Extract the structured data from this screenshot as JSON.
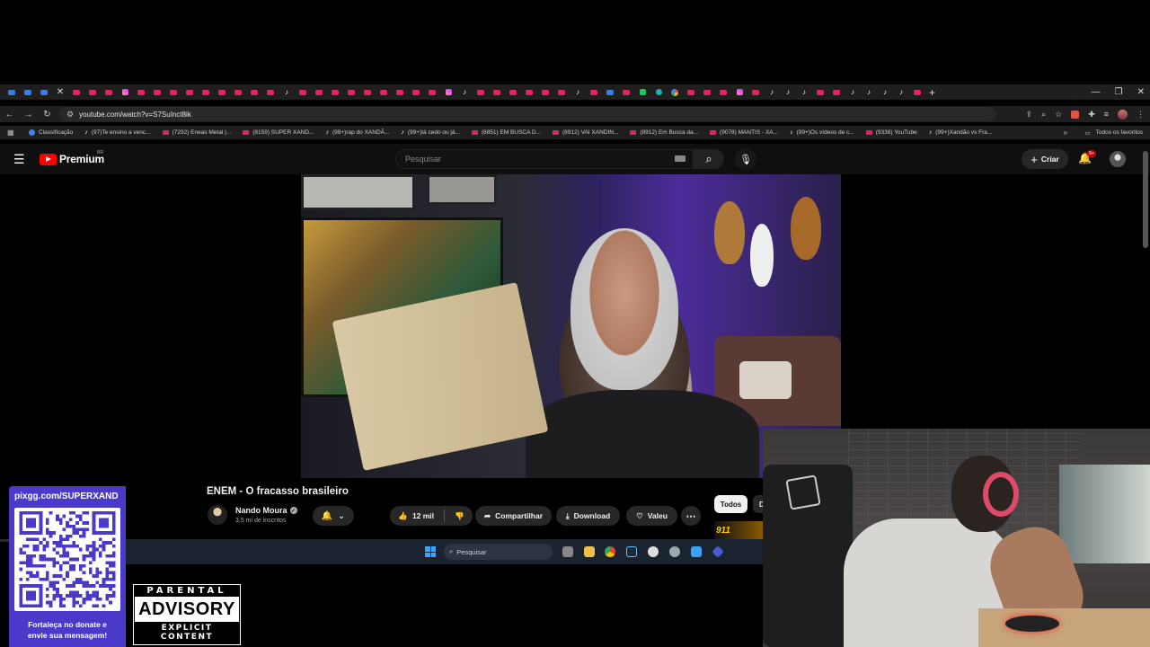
{
  "browser": {
    "url": "youtube.com/watch?v=S7SuInct8ik",
    "bookmarks": [
      {
        "label": "Classificação",
        "icon": "globe"
      },
      {
        "label": "(97)Te ensino a venc...",
        "icon": "tiktok"
      },
      {
        "label": "(7292) Eneas Metal |...",
        "icon": "youtube"
      },
      {
        "label": "(8159) SUPER XAND...",
        "icon": "youtube"
      },
      {
        "label": "(99+)rap do XANDÃ...",
        "icon": "tiktok"
      },
      {
        "label": "(99+)tá cedo ou já...",
        "icon": "tiktok"
      },
      {
        "label": "(8851) EM BUSCA D...",
        "icon": "youtube"
      },
      {
        "label": "(8912) VAI XANDIN...",
        "icon": "youtube"
      },
      {
        "label": "(8912) Em Busca da...",
        "icon": "youtube"
      },
      {
        "label": "(9078) MANTIS - XA...",
        "icon": "youtube"
      },
      {
        "label": "(99+)Os vídeos de c...",
        "icon": "tiktok"
      },
      {
        "label": "(9338) YouTube",
        "icon": "youtube"
      },
      {
        "label": "(99+)Xandão vs Fra...",
        "icon": "tiktok"
      }
    ],
    "all_bookmarks_label": "Todos os favoritos"
  },
  "youtube": {
    "logo_text": "Premium",
    "country": "BR",
    "search_placeholder": "Pesquisar",
    "create_label": "Criar",
    "notifications_badge": "9+",
    "video": {
      "title": "ENEM - O fracasso brasileiro",
      "channel": "Nando Moura",
      "subscribers": "3,5 mi de inscritos",
      "likes": "12 mil",
      "share_label": "Compartilhar",
      "download_label": "Download",
      "thanks_label": "Valeu"
    },
    "chips": {
      "all": "Todos",
      "next_initial": "D"
    },
    "ad_text": "911"
  },
  "taskbar": {
    "search_placeholder": "Pesquisar"
  },
  "overlay": {
    "donate_url": "pixgg.com/SUPERXAND",
    "donate_message_line1": "Fortaleça no donate e",
    "donate_message_line2": "envie sua mensagem!",
    "advisory_top": "PARENTAL",
    "advisory_middle": "ADVISORY",
    "advisory_bottom": "EXPLICIT CONTENT"
  },
  "colors": {
    "youtube_red": "#ff0000",
    "donate_purple": "#4b39c9",
    "headset_pink": "#e04a6a"
  }
}
